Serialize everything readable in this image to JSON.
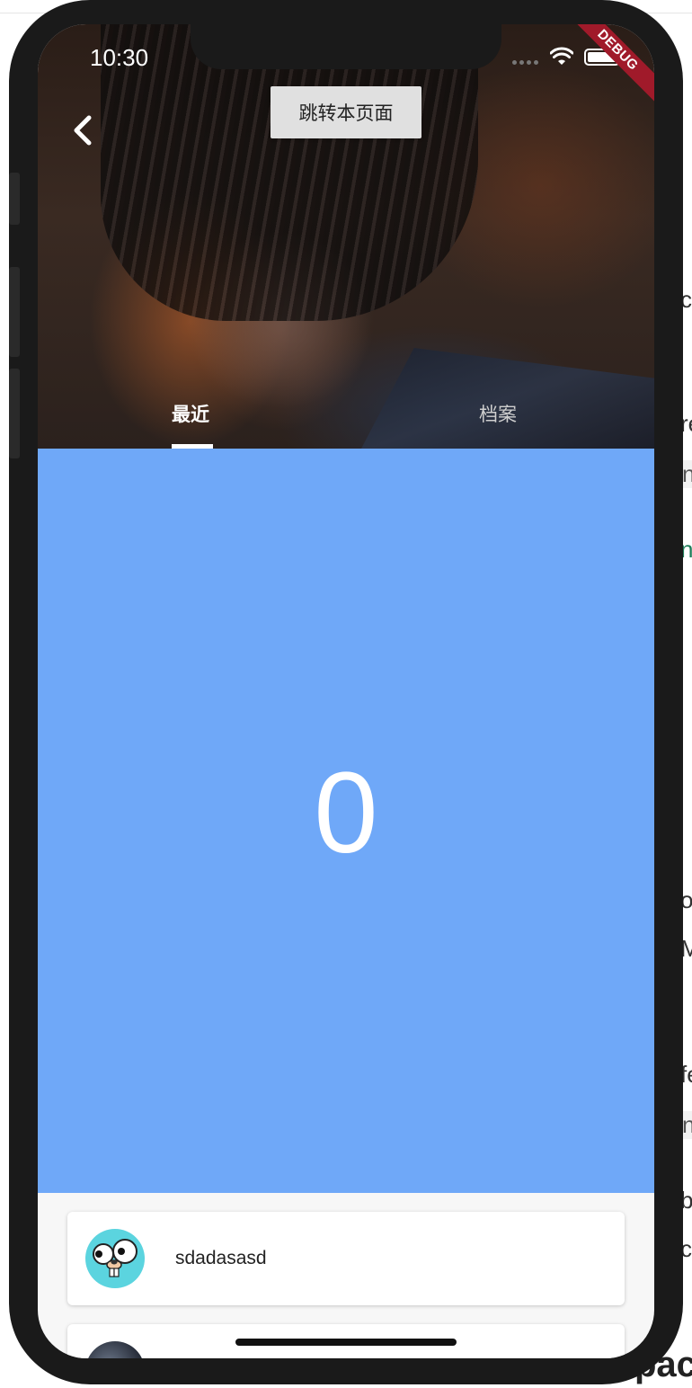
{
  "status_bar": {
    "time": "10:30",
    "wifi_icon": "wifi-icon",
    "battery_icon": "battery-icon"
  },
  "debug_banner": {
    "label": "DEBUG",
    "color": "#a01a2a"
  },
  "app_bar": {
    "back_icon": "chevron-left-icon",
    "jump_button_label": "跳转本页面"
  },
  "tabs": [
    {
      "label": "最近",
      "selected": true
    },
    {
      "label": "档案",
      "selected": false
    }
  ],
  "counter": {
    "value": "0",
    "background": "#6fa8f8"
  },
  "list": {
    "items": [
      {
        "title": "sdadasasd",
        "avatar_icon": "gopher-avatar-icon"
      },
      {
        "title": "",
        "avatar_icon": "photo-avatar-icon"
      }
    ]
  },
  "background_page": {
    "fragments": [
      "c",
      "re",
      "n",
      "n",
      "ol",
      "M",
      "fe",
      "n",
      "b",
      "c",
      "pac"
    ]
  }
}
